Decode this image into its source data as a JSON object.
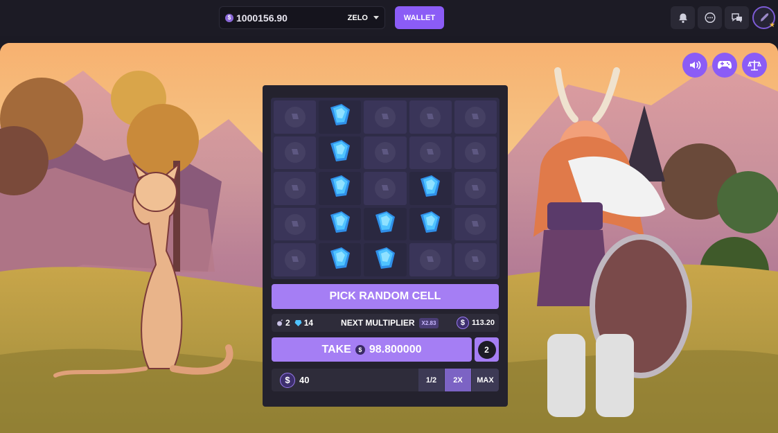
{
  "header": {
    "balance": "1000156.90",
    "currency": "ZELO",
    "wallet_label": "WALLET",
    "icons": [
      "bell-icon",
      "chat-bubble-icon",
      "messages-icon",
      "avatar"
    ]
  },
  "scene": {
    "controls": [
      "sound-icon",
      "gamepad-icon",
      "balance-scale-icon"
    ]
  },
  "game": {
    "grid": [
      [
        "hidden",
        "gem",
        "hidden",
        "hidden",
        "hidden"
      ],
      [
        "hidden",
        "gem",
        "hidden",
        "hidden",
        "hidden"
      ],
      [
        "hidden",
        "gem",
        "hidden",
        "gem",
        "hidden"
      ],
      [
        "hidden",
        "gem",
        "gem",
        "gem",
        "hidden"
      ],
      [
        "hidden",
        "gem",
        "gem",
        "hidden",
        "hidden"
      ]
    ],
    "random_label": "PICK RANDOM CELL",
    "mines_count": "2",
    "gems_count": "14",
    "next_multiplier_label": "NEXT MULTIPLIER",
    "next_multiplier": "X2.83",
    "next_profit": "113.20",
    "take_label": "TAKE",
    "take_amount": "98.800000",
    "picked_count": "2",
    "bet_amount": "40",
    "half_label": "1/2",
    "double_label": "2X",
    "max_label": "MAX"
  },
  "colors": {
    "accent": "#a57ef4",
    "brand": "#8b5cf6",
    "gem": "#4fc3ff",
    "panel": "#24222e"
  }
}
